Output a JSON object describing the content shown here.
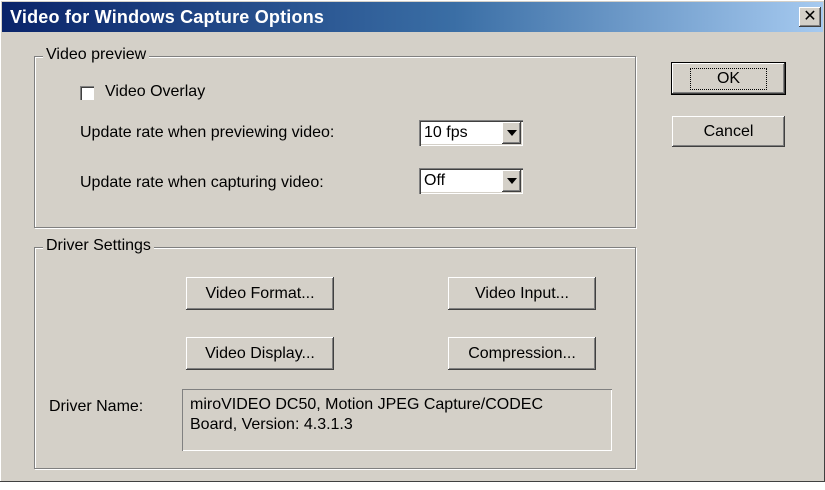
{
  "window": {
    "title": "Video for Windows Capture Options",
    "close_glyph": "✕"
  },
  "video_preview": {
    "legend": "Video preview",
    "overlay_label": "Video Overlay",
    "overlay_checked": false,
    "preview_rate_label": "Update rate when previewing video:",
    "preview_rate_value": "10 fps",
    "capture_rate_label": "Update rate when capturing video:",
    "capture_rate_value": "Off"
  },
  "driver_settings": {
    "legend": "Driver Settings",
    "video_format_label": "Video Format...",
    "video_input_label": "Video Input...",
    "video_display_label": "Video Display...",
    "compression_label": "Compression...",
    "driver_name_label": "Driver Name:",
    "driver_name_line1": "miroVIDEO DC50, Motion JPEG Capture/CODEC",
    "driver_name_line2": "Board, Version:  4.3.1.3"
  },
  "buttons": {
    "ok_label": "OK",
    "cancel_label": "Cancel"
  },
  "icons": {
    "close": "close-icon",
    "dropdown": "chevron-down-icon"
  }
}
